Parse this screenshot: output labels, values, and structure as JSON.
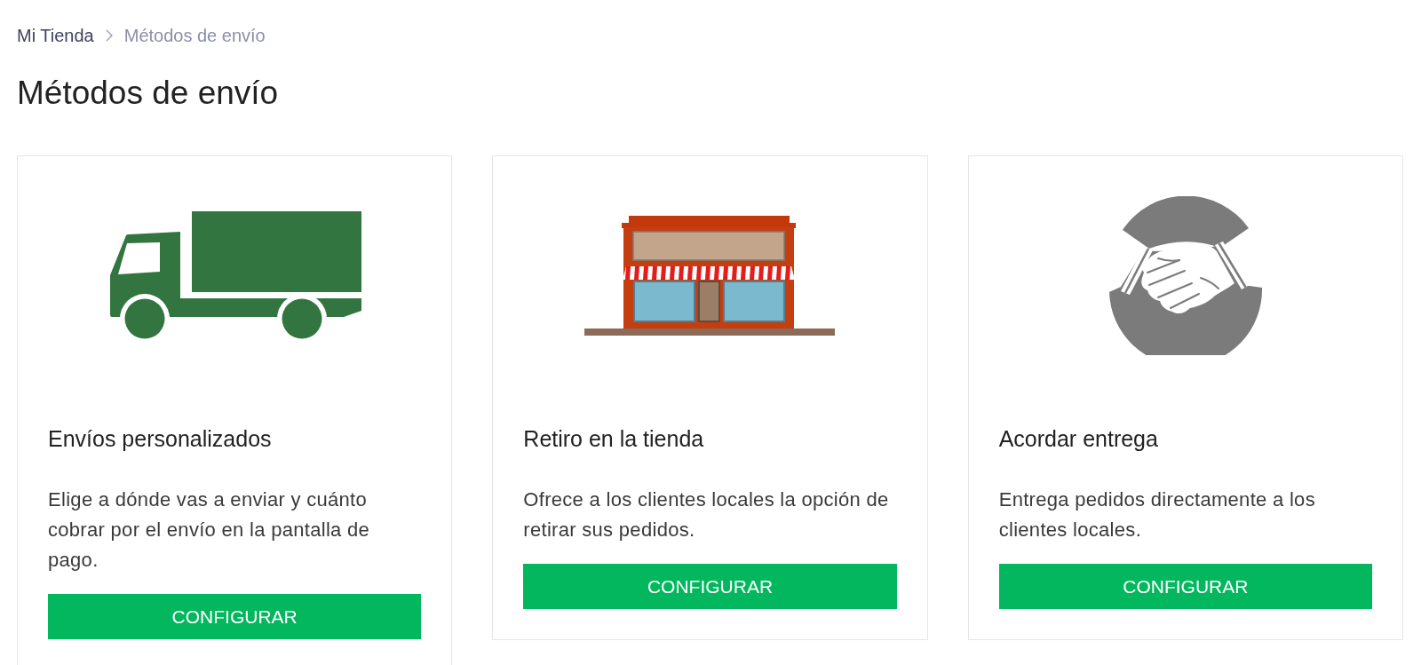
{
  "breadcrumb": [
    {
      "label": "Mi Tienda",
      "current": false
    },
    {
      "label": "Métodos de envío",
      "current": true
    }
  ],
  "title": "Métodos de envío",
  "methods": [
    {
      "kind": "truck",
      "title": "Envíos personalizados",
      "description": "Elige a dónde vas a enviar y cuánto cobrar por el envío en la pantalla de pago.",
      "button": "CONFIGURAR"
    },
    {
      "kind": "store",
      "title": "Retiro en la tienda",
      "description": "Ofrece a los clientes locales la opción de retirar sus pedidos.",
      "button": "CONFIGURAR"
    },
    {
      "kind": "handshake",
      "title": "Acordar entrega",
      "description": "Entrega pedidos directamente a los clientes locales.",
      "button": "CONFIGURAR"
    }
  ]
}
